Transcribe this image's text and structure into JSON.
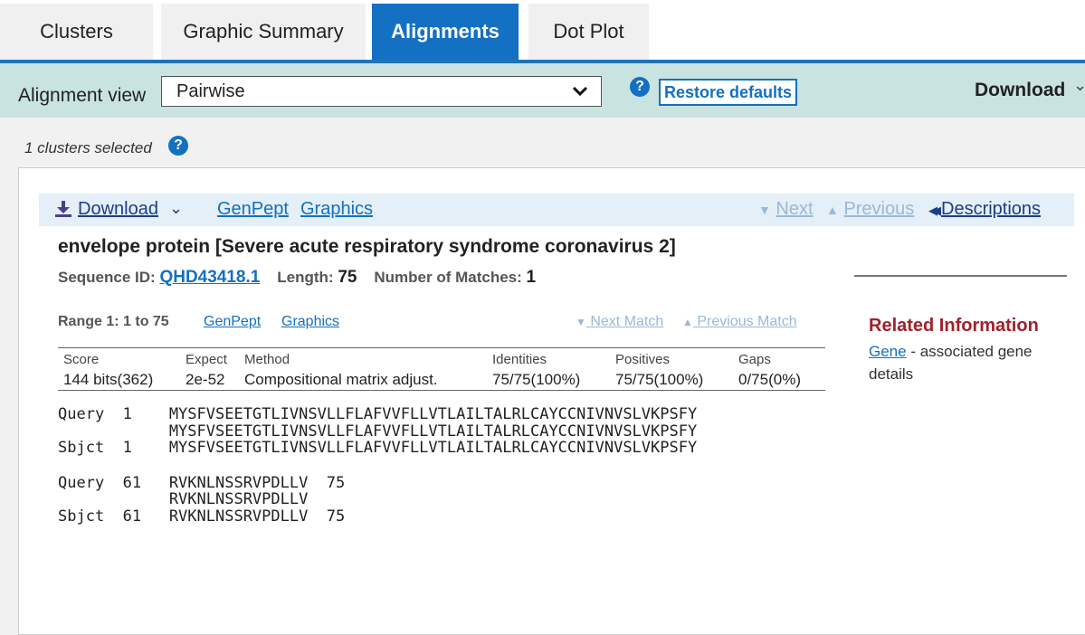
{
  "tabs": [
    "Clusters",
    "Graphic Summary",
    "Alignments",
    "Dot Plot"
  ],
  "toolbar": {
    "alignment_view_label": "Alignment view",
    "alignment_view_value": "Pairwise",
    "restore_defaults": "Restore defaults",
    "download": "Download"
  },
  "selection": {
    "text": "1 clusters selected"
  },
  "panel": {
    "download": "Download",
    "genpept": "GenPept",
    "graphics": "Graphics",
    "next": "Next",
    "previous": "Previous",
    "descriptions": "Descriptions",
    "title": "envelope protein [Severe acute respiratory syndrome coronavirus 2]",
    "sequence_id_label": "Sequence ID:",
    "sequence_id": "QHD43418.1",
    "length_label": "Length:",
    "length": "75",
    "matches_label": "Number of Matches:",
    "matches": "1",
    "range_label": "Range 1: 1 to 75",
    "range_genpept": "GenPept",
    "range_graphics": "Graphics",
    "next_match": "Next Match",
    "previous_match": "Previous Match"
  },
  "stats": {
    "headers": [
      "Score",
      "Expect",
      "Method",
      "Identities",
      "Positives",
      "Gaps"
    ],
    "values": [
      "144 bits(362)",
      "2e-52",
      "Compositional matrix adjust.",
      "75/75(100%)",
      "75/75(100%)",
      "0/75(0%)"
    ]
  },
  "alignment": {
    "blocks": [
      {
        "query": "Query  1    MYSFVSEETGTLIVNSVLLFLAFVVFLLVTLAILTALRLCAYCCNIVNVSLVKPSFY",
        "middle": "            MYSFVSEETGTLIVNSVLLFLAFVVFLLVTLAILTALRLCAYCCNIVNVSLVKPSFY",
        "sbjct": "Sbjct  1    MYSFVSEETGTLIVNSVLLFLAFVVFLLVTLAILTALRLCAYCCNIVNVSLVKPSFY"
      },
      {
        "query": "Query  61   RVKNLNSSRVPDLLV  75",
        "middle": "            RVKNLNSSRVPDLLV",
        "sbjct": "Sbjct  61   RVKNLNSSRVPDLLV  75"
      }
    ]
  },
  "related": {
    "title": "Related Information",
    "gene_link": "Gene",
    "gene_desc": " - associated gene details"
  },
  "icons": {
    "help": "?",
    "chevron": "⌄",
    "next_arrow": "▼",
    "prev_arrow": "▲",
    "desc_arrow": "◀◀"
  },
  "colors": {
    "accent": "#1370c2",
    "toolbar_bg": "#c9e3e1",
    "related_title": "#a0202b"
  }
}
